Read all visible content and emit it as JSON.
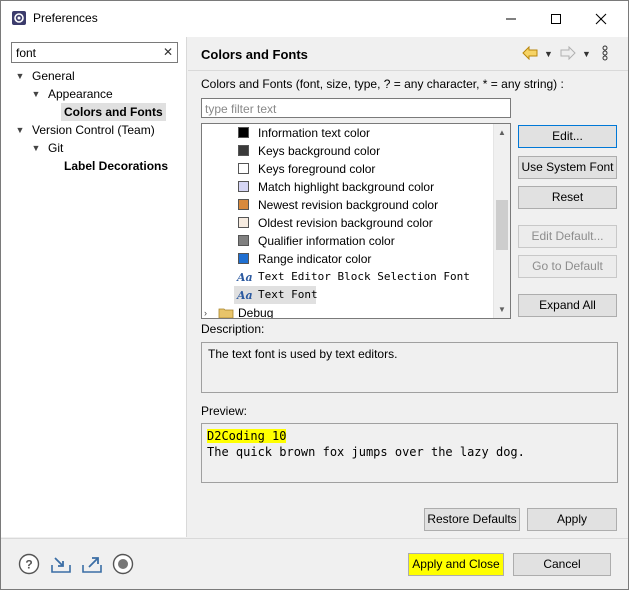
{
  "window": {
    "title": "Preferences"
  },
  "search": {
    "value": "font"
  },
  "tree": {
    "general": "General",
    "appearance": "Appearance",
    "colors_and_fonts": "Colors and Fonts",
    "version_control": "Version Control (Team)",
    "git": "Git",
    "label_decorations": "Label Decorations"
  },
  "page": {
    "title": "Colors and Fonts",
    "intro": "Colors and Fonts (font, size, type, ? = any character, * = any string) :",
    "filter_placeholder": "type filter text"
  },
  "list": {
    "items": [
      {
        "label": "Information text color",
        "color": "#000000"
      },
      {
        "label": "Keys background color",
        "color": "#3a3a3a"
      },
      {
        "label": "Keys foreground color",
        "color": "#ffffff"
      },
      {
        "label": "Match highlight background color",
        "color": "#d6d6f5"
      },
      {
        "label": "Newest revision background color",
        "color": "#d8893c"
      },
      {
        "label": "Oldest revision background color",
        "color": "#f6ebe0"
      },
      {
        "label": "Qualifier information color",
        "color": "#808080"
      },
      {
        "label": "Range indicator color",
        "color": "#1f6fd1"
      }
    ],
    "font_items": [
      {
        "label": "Text Editor Block Selection Font"
      },
      {
        "label": "Text Font"
      }
    ],
    "category": "Debug"
  },
  "buttons": {
    "edit": "Edit...",
    "use_system_font": "Use System Font",
    "reset": "Reset",
    "edit_default": "Edit Default...",
    "go_to_default": "Go to Default",
    "expand_all": "Expand All",
    "restore_defaults": "Restore Defaults",
    "apply": "Apply",
    "apply_and_close": "Apply and Close",
    "cancel": "Cancel"
  },
  "description": {
    "label": "Description:",
    "text": "The text font is used by text editors."
  },
  "preview": {
    "label": "Preview:",
    "font_name": "D2Coding 10",
    "sample": "The quick brown fox jumps over the lazy dog."
  },
  "colors": {
    "highlight": "#ffff00",
    "accent": "#0078d7"
  }
}
